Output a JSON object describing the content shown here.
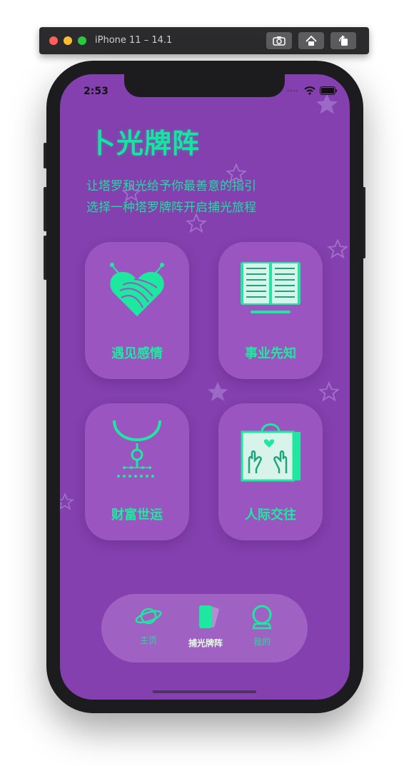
{
  "simulator": {
    "title": "iPhone 11 – 14.1"
  },
  "status_bar": {
    "time": "2:53"
  },
  "page": {
    "title": "卜光牌阵",
    "subtitle_lines": [
      "让塔罗和光给予你最善意的指引",
      "选择一种塔罗牌阵开启捕光旅程"
    ]
  },
  "cards": [
    {
      "label": "遇见感情",
      "icon": "heart-yarn-icon"
    },
    {
      "label": "事业先知",
      "icon": "open-book-icon"
    },
    {
      "label": "财富世运",
      "icon": "necklace-icon"
    },
    {
      "label": "人际交往",
      "icon": "gift-bag-hands-icon"
    }
  ],
  "tabbar": {
    "tabs": [
      {
        "label": "主页",
        "icon": "planet-icon",
        "active": false
      },
      {
        "label": "捕光牌阵",
        "icon": "cards-icon",
        "active": true
      },
      {
        "label": "我的",
        "icon": "crystal-ball-icon",
        "active": false
      }
    ]
  },
  "colors": {
    "background": "#8340ae",
    "card": "#9a55c0",
    "accent": "#16e5a2",
    "tabbar": "#9f62c3"
  }
}
